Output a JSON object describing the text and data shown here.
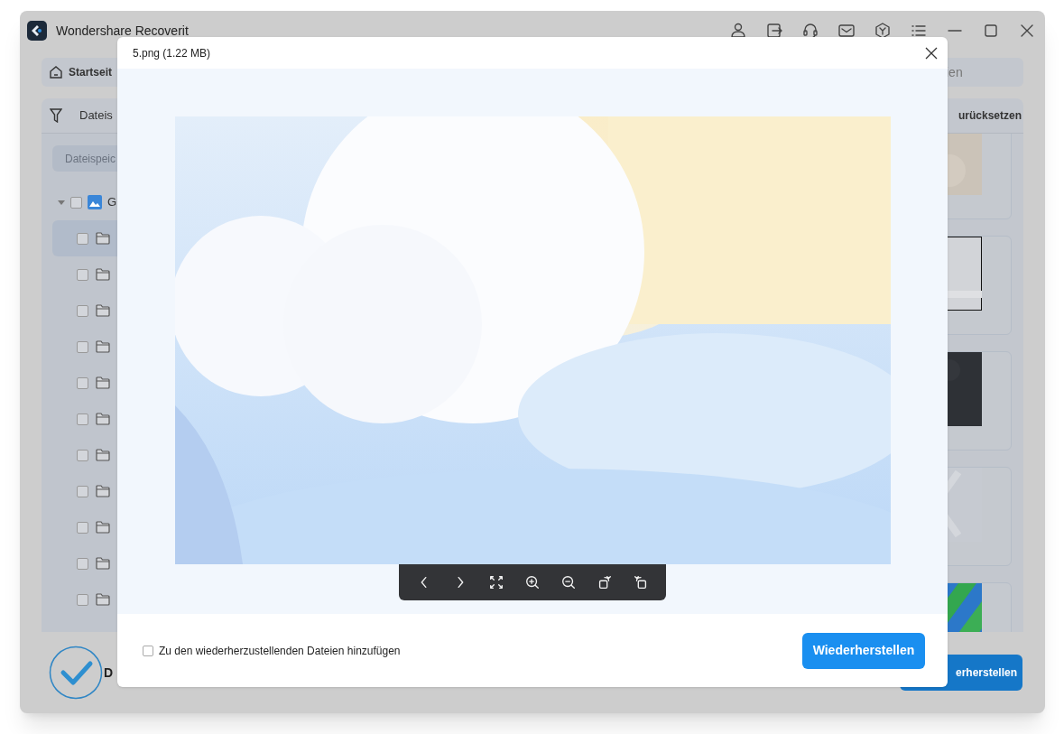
{
  "app": {
    "title": "Wondershare Recoverit",
    "title_tools": [
      {
        "kind": "account"
      },
      {
        "kind": "export"
      },
      {
        "kind": "support"
      },
      {
        "kind": "mail"
      },
      {
        "kind": "cube"
      },
      {
        "kind": "menu"
      },
      {
        "kind": "minimize"
      },
      {
        "kind": "maximize"
      },
      {
        "kind": "close"
      }
    ],
    "nav": {
      "label": "Startseit"
    },
    "search": {
      "value": "ien"
    },
    "filter": {
      "label": "Dateis"
    },
    "reset": {
      "label": "urücksetzen"
    },
    "storage_button": {
      "label": "Dateispeic"
    },
    "tree": [
      {
        "label": "G",
        "expanded": true,
        "checked": false,
        "children": [
          {
            "selected": true,
            "checked": false
          },
          {
            "selected": false,
            "checked": false
          },
          {
            "selected": false,
            "checked": false
          },
          {
            "selected": false,
            "checked": false
          },
          {
            "selected": false,
            "checked": false
          },
          {
            "selected": false,
            "checked": false
          },
          {
            "selected": false,
            "checked": false
          },
          {
            "selected": false,
            "checked": false
          },
          {
            "selected": false,
            "checked": false
          },
          {
            "selected": false,
            "checked": false
          },
          {
            "selected": false,
            "checked": false
          }
        ]
      }
    ],
    "status": {
      "label": "D"
    },
    "recover_button": {
      "label": "erherstellen"
    }
  },
  "preview": {
    "title": "5.png (1.22 MB)",
    "tools": [
      {
        "kind": "previous"
      },
      {
        "kind": "next"
      },
      {
        "kind": "fit"
      },
      {
        "kind": "zoom-in"
      },
      {
        "kind": "zoom-out"
      },
      {
        "kind": "rotate-left"
      },
      {
        "kind": "rotate-right"
      }
    ],
    "add_to_recovery": {
      "label": "Zu den wiederherzustellenden Dateien hinzufügen",
      "checked": false
    },
    "restore_button": {
      "label": "Wiederherstellen"
    }
  }
}
